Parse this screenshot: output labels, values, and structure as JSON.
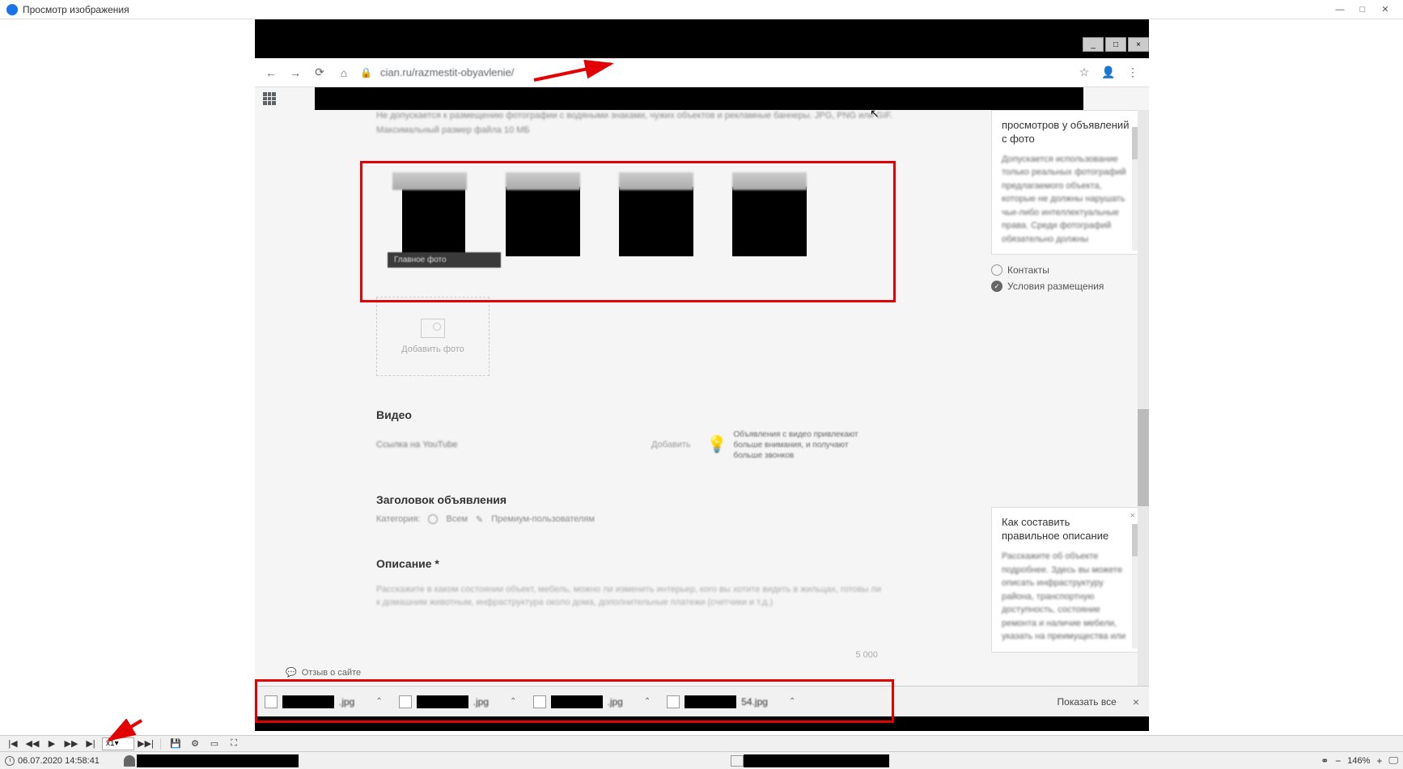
{
  "viewer": {
    "title": "Просмотр изображения",
    "timestamp": "06.07.2020 14:58:41",
    "speed": "x1",
    "zoom": "146%"
  },
  "browser": {
    "url": "cian.ru/razmestit-obyavlenie/",
    "bookmarks_apps": "Приложения"
  },
  "page": {
    "photo_hint_1": "Не допускается к размещению фотографии с водяными знаками, чужих объектов и рекламные баннеры. JPG, PNG или GIF.",
    "photo_hint_2": "Максимальный размер файла 10 МБ",
    "main_photo_label": "Главное фото",
    "add_photo": "Добавить фото",
    "video_heading": "Видео",
    "video_placeholder": "Ссылка на YouTube",
    "video_button": "Добавить",
    "video_tip": "Объявления с видео привлекают больше внимания, и получают больше звонков",
    "title_heading": "Заголовок объявления",
    "title_category": "Категория:",
    "title_opt_all": "Всем",
    "title_opt_premium": "Премиум-пользователям",
    "desc_heading": "Описание *",
    "desc_placeholder": "Расскажите в каком состоянии объект, мебель, можно ли изменить интерьер, кого вы хотите видеть в жильцах, готовы ли к домашним животным, инфраструктура около дома, дополнительные платежи (счетчики и т.д.)",
    "char_limit": "5 000",
    "feedback": "Отзыв о сайте"
  },
  "sidebar": {
    "box1_title": "просмотров у объявлений с фото",
    "box1_text": "Допускается использование только реальных фотографий предлагаемого объекта, которые не должны нарушать чьи-либо интеллектуальные права. Среди фотографий обязательно должны",
    "link_contacts": "Контакты",
    "link_terms": "Условия размещения",
    "box2_title": "Как составить правильное описание",
    "box2_text": "Расскажите об объекте подробнее. Здесь вы можете описать инфраструктуру района, транспортную доступность, состояние ремонта и наличие мебели, указать на преимущества или"
  },
  "downloads": {
    "items": [
      {
        "ext": ".jpg"
      },
      {
        "ext": ".jpg"
      },
      {
        "ext": ".jpg"
      },
      {
        "ext": "54.jpg"
      }
    ],
    "show_all": "Показать все"
  }
}
